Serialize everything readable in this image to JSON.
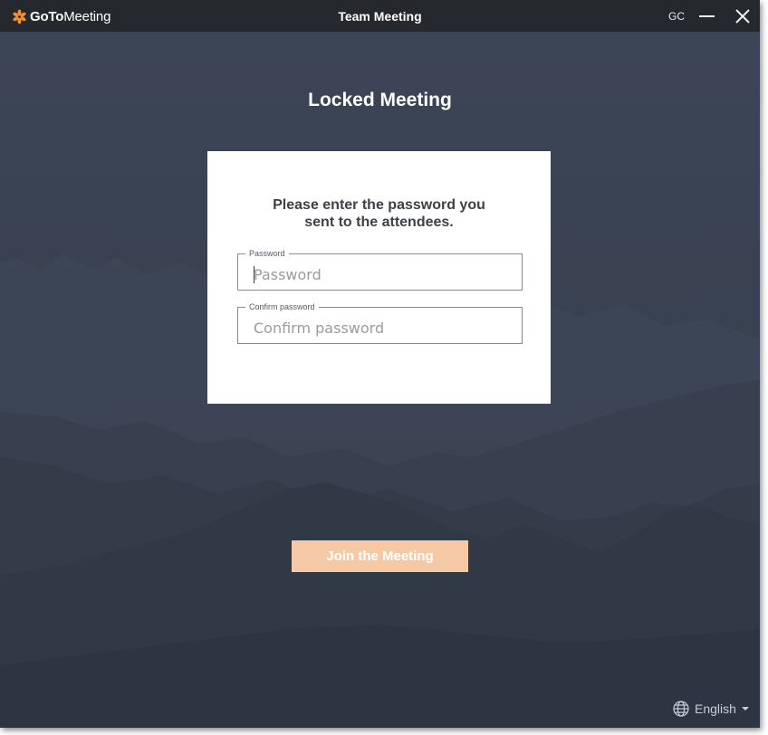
{
  "titlebar": {
    "app_logo_bold": "GoTo",
    "app_logo_light": "Meeting",
    "window_title": "Team Meeting",
    "user_initials": "GC",
    "icons": [
      "gotomeeting-logo-icon",
      "minimize-icon",
      "close-icon"
    ]
  },
  "main": {
    "heading": "Locked Meeting",
    "prompt_line1": "Please enter the password you",
    "prompt_line2": "sent to the attendees.",
    "password_label": "Password",
    "password_placeholder": "Password",
    "password_value": "",
    "confirm_label": "Confirm password",
    "confirm_placeholder": "Confirm password",
    "confirm_value": "",
    "join_button": "Join the Meeting"
  },
  "footer": {
    "language": "English",
    "icons": [
      "globe-icon",
      "chevron-down-icon"
    ]
  },
  "colors": {
    "titlebar_bg": "#25282d",
    "window_bg": "#3a4354",
    "brand_orange": "#f68d2e",
    "join_button_bg": "#f5c9a6"
  }
}
